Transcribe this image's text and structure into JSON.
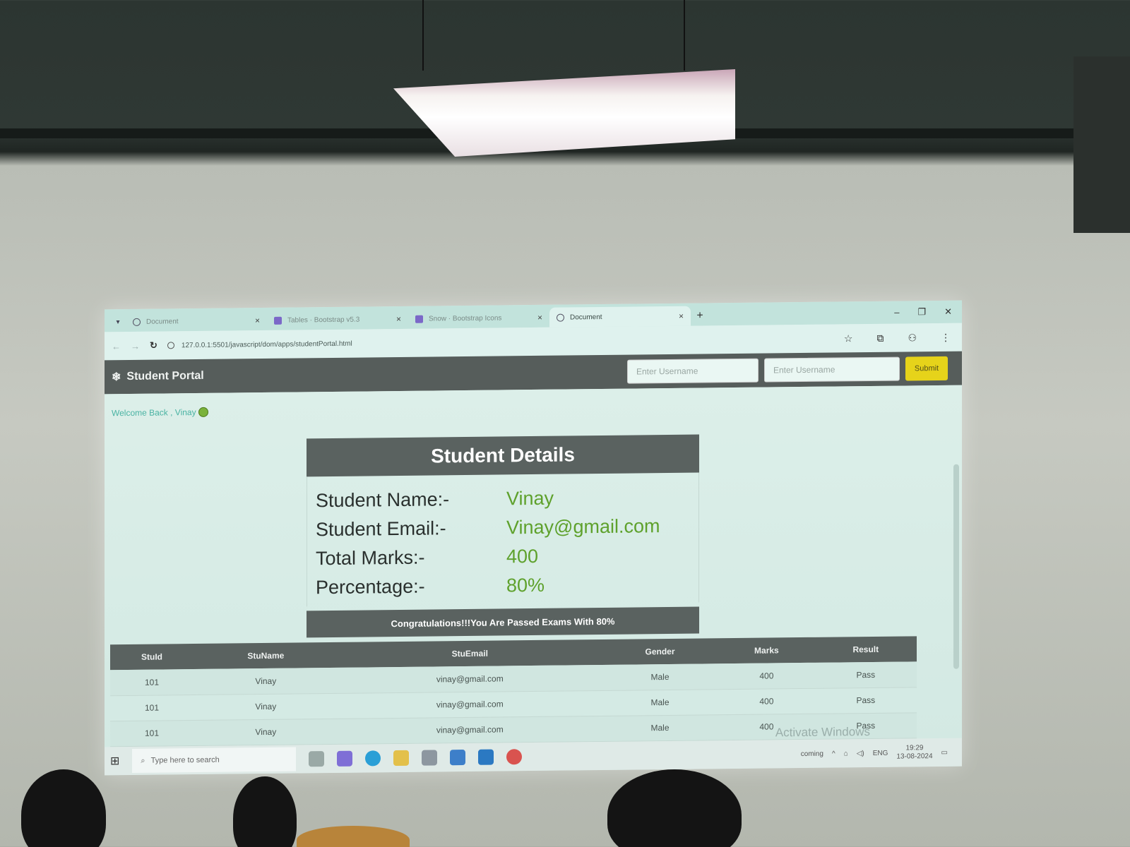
{
  "browser": {
    "tabs": [
      {
        "title": "Document",
        "active": false,
        "icon": "globe-icon"
      },
      {
        "title": "Tables · Bootstrap v5.3",
        "active": false,
        "icon": "bootstrap-icon"
      },
      {
        "title": "Snow · Bootstrap Icons",
        "active": false,
        "icon": "bootstrap-icon"
      },
      {
        "title": "Document",
        "active": true,
        "icon": "globe-icon"
      }
    ],
    "new_tab": "+",
    "url": "127.0.0.1:5501/javascript/dom/apps/studentPortal.html"
  },
  "navbar": {
    "brand": "Student Portal",
    "username_placeholder_1": "Enter Username",
    "username_placeholder_2": "Enter Username",
    "submit_label": "Submit"
  },
  "welcome": {
    "text": "Welcome Back , Vinay"
  },
  "student_card": {
    "title": "Student Details",
    "rows": [
      {
        "label": "Student Name:-",
        "value": "Vinay"
      },
      {
        "label": "Student Email:-",
        "value": "Vinay@gmail.com"
      },
      {
        "label": "Total Marks:-",
        "value": "400"
      },
      {
        "label": "Percentage:-",
        "value": "80%"
      }
    ],
    "footer": "Congratulations!!!You Are Passed Exams With 80%"
  },
  "table": {
    "headers": [
      "StuId",
      "StuName",
      "StuEmail",
      "Gender",
      "Marks",
      "Result"
    ],
    "rows": [
      [
        "101",
        "Vinay",
        "vinay@gmail.com",
        "Male",
        "400",
        "Pass"
      ],
      [
        "101",
        "Vinay",
        "vinay@gmail.com",
        "Male",
        "400",
        "Pass"
      ],
      [
        "101",
        "Vinay",
        "vinay@gmail.com",
        "Male",
        "400",
        "Pass"
      ]
    ]
  },
  "watermark": "Activate Windows",
  "taskbar": {
    "search_placeholder": "Type here to search",
    "weather": "coming",
    "language": "ENG",
    "time": "19:29",
    "date": "13-08-2024"
  },
  "colors": {
    "accent_yellow": "#e6d31a",
    "value_green": "#5ea12c",
    "navbar": "#565d5b"
  }
}
